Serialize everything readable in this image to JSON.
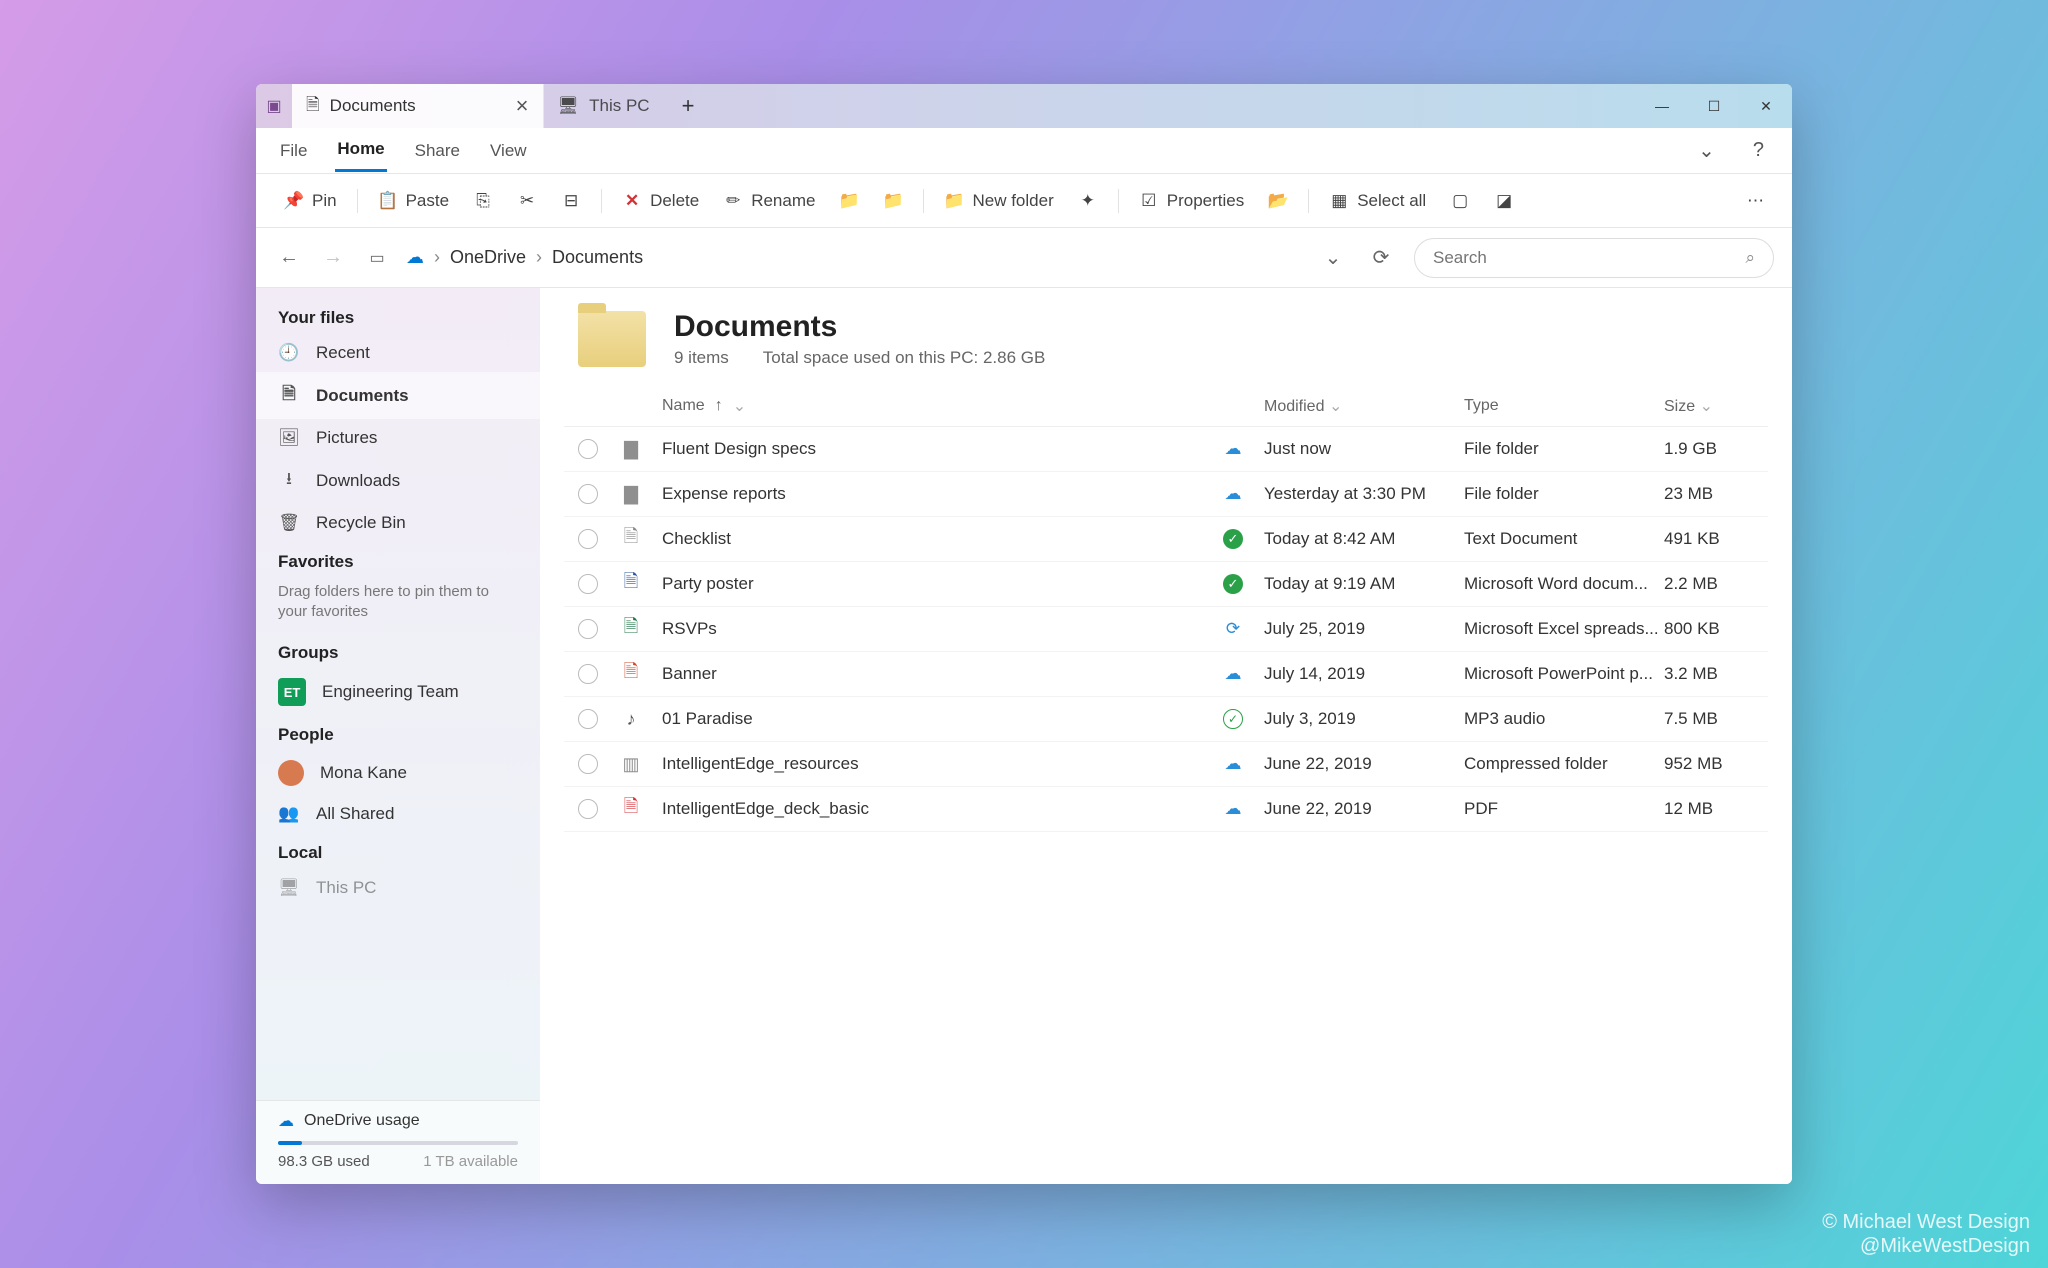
{
  "credit": {
    "line1": "© Michael West Design",
    "line2": "@MikeWestDesign"
  },
  "tabs": [
    {
      "label": "Documents",
      "active": true
    },
    {
      "label": "This PC",
      "active": false
    }
  ],
  "ribbon": {
    "tabs": [
      "File",
      "Home",
      "Share",
      "View"
    ],
    "active": "Home"
  },
  "toolbar": {
    "pin": "Pin",
    "paste": "Paste",
    "delete": "Delete",
    "rename": "Rename",
    "newfolder": "New folder",
    "properties": "Properties",
    "selectall": "Select all"
  },
  "breadcrumb": [
    "OneDrive",
    "Documents"
  ],
  "search": {
    "placeholder": "Search"
  },
  "sidebar": {
    "your_files": "Your files",
    "items": [
      {
        "icon": "clock",
        "label": "Recent"
      },
      {
        "icon": "doc",
        "label": "Documents",
        "active": true
      },
      {
        "icon": "image",
        "label": "Pictures"
      },
      {
        "icon": "download",
        "label": "Downloads"
      },
      {
        "icon": "trash",
        "label": "Recycle Bin"
      }
    ],
    "favorites": "Favorites",
    "fav_hint": "Drag folders here to pin them to your favorites",
    "groups": "Groups",
    "group_item": {
      "chip": "ET",
      "label": "Engineering Team"
    },
    "people": "People",
    "person": "Mona Kane",
    "all_shared": "All Shared",
    "local": "Local",
    "local_item": "This PC",
    "usage": {
      "title": "OneDrive usage",
      "used": "98.3 GB used",
      "avail": "1 TB available",
      "fill_pct": 10
    }
  },
  "header": {
    "title": "Documents",
    "items_count": "9 items",
    "space": "Total space used on this PC: 2.86 GB"
  },
  "columns": {
    "name": "Name",
    "modified": "Modified",
    "type": "Type",
    "size": "Size"
  },
  "files": [
    {
      "icon": "folder",
      "name": "Fluent Design specs",
      "sync": "cloud",
      "modified": "Just now",
      "type": "File folder",
      "size": "1.9 GB"
    },
    {
      "icon": "folder",
      "name": "Expense reports",
      "sync": "cloud",
      "modified": "Yesterday at 3:30 PM",
      "type": "File folder",
      "size": "23 MB"
    },
    {
      "icon": "txt",
      "name": "Checklist",
      "sync": "done",
      "modified": "Today at 8:42 AM",
      "type": "Text Document",
      "size": "491 KB"
    },
    {
      "icon": "word",
      "name": "Party poster",
      "sync": "done",
      "modified": "Today at 9:19 AM",
      "type": "Microsoft Word docum...",
      "size": "2.2 MB"
    },
    {
      "icon": "excel",
      "name": "RSVPs",
      "sync": "syncing",
      "modified": "July 25, 2019",
      "type": "Microsoft Excel spreads...",
      "size": "800 KB"
    },
    {
      "icon": "ppt",
      "name": "Banner",
      "sync": "cloud",
      "modified": "July 14, 2019",
      "type": "Microsoft PowerPoint p...",
      "size": "3.2 MB"
    },
    {
      "icon": "audio",
      "name": "01 Paradise",
      "sync": "local",
      "modified": "July 3, 2019",
      "type": "MP3 audio",
      "size": "7.5 MB"
    },
    {
      "icon": "zip",
      "name": "IntelligentEdge_resources",
      "sync": "cloud",
      "modified": "June 22, 2019",
      "type": "Compressed folder",
      "size": "952 MB"
    },
    {
      "icon": "pdf",
      "name": "IntelligentEdge_deck_basic",
      "sync": "cloud",
      "modified": "June 22, 2019",
      "type": "PDF",
      "size": "12 MB"
    }
  ]
}
